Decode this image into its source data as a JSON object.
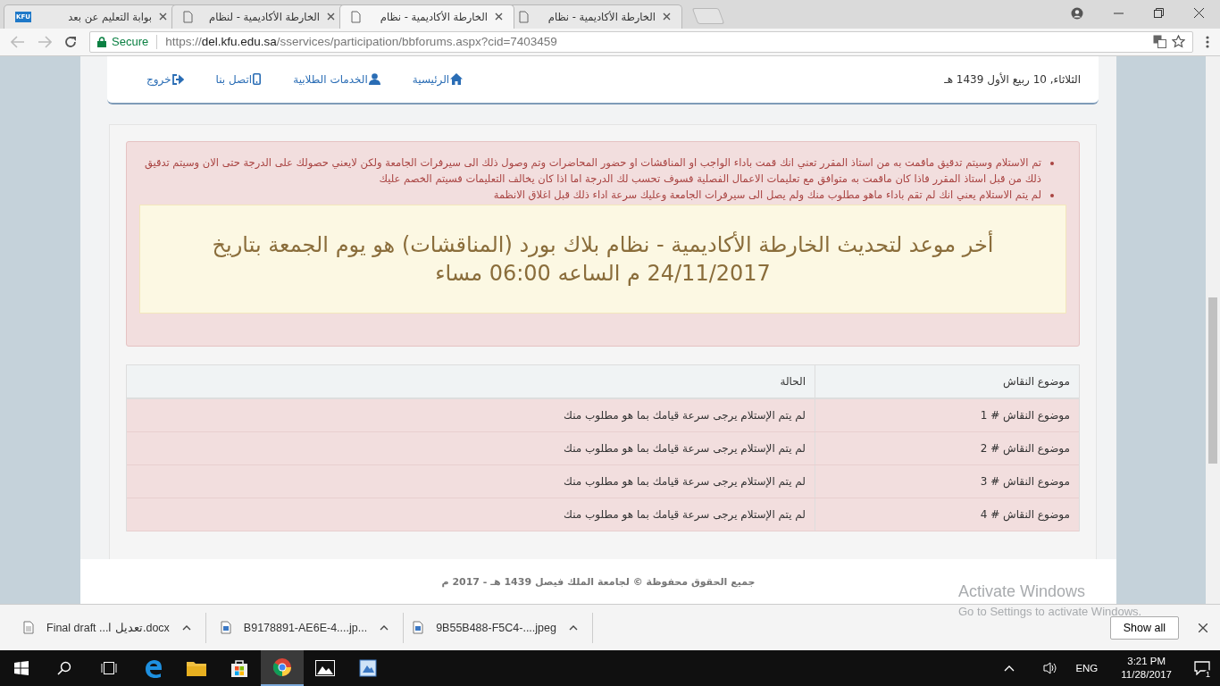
{
  "tabs": [
    {
      "title": "الخارطة الأكاديمية - نظام",
      "kind": "page",
      "selected": false
    },
    {
      "title": "الخارطة الأكاديمية - نظام",
      "kind": "page",
      "selected": true
    },
    {
      "title": "الخارطة الأكاديمية - لنظام",
      "kind": "page",
      "selected": false
    },
    {
      "title": "بوابة التعليم عن بعد",
      "kind": "logo",
      "logo_text": "KFU",
      "selected": false
    }
  ],
  "address_bar": {
    "secure_label": "Secure",
    "url_scheme": "https://",
    "url_host": "del.kfu.edu.sa",
    "url_path": "/sservices/participation/bbforums.aspx?cid=7403459"
  },
  "header": {
    "date": "الثلاثاء, 10 ربيع الأول 1439 هـ",
    "nav": [
      {
        "label": "الرئيسية",
        "kind": "home"
      },
      {
        "label": "الخدمات الطلابية",
        "kind": "user"
      },
      {
        "label": "اتصل بنا",
        "kind": "phone"
      },
      {
        "label": "خروج",
        "kind": "logout"
      }
    ]
  },
  "alert": {
    "bullets": [
      "تم الاستلام وسيتم تدقيق ماقمت به من استاذ المقرر تعني انك قمت باداء الواجب او المناقشات او حضور المحاضرات وتم وصول ذلك الى سيرفرات الجامعة ولكن لايعني حصولك على الدرجة حتى الان وسيتم تدقيق ذلك من قبل استاذ المقرر فاذا كان ماقمت به متوافق مع تعليمات الاعمال الفصلية فسوف تحسب لك الدرجة اما اذا كان يخالف التعليمات فسيتم الخصم عليك",
      "لم يتم الاستلام يعني انك لم تقم باداء ماهو مطلوب منك ولم يصل الى سيرفرات الجامعة وعليك سرعة اداء ذلك قبل اغلاق الانظمة"
    ],
    "notice": "أخر موعد لتحديث الخارطة الأكاديمية - نظام بلاك بورد (المناقشات) هو يوم الجمعة بتاريخ 24/11/2017 م الساعه 06:00 مساء"
  },
  "table": {
    "columns": [
      "موضوع النقاش",
      "الحالة"
    ],
    "rows": [
      [
        "موضوع النقاش # 1",
        "لم يتم الإستلام يرجى سرعة قيامك بما هو مطلوب منك"
      ],
      [
        "موضوع النقاش # 2",
        "لم يتم الإستلام يرجى سرعة قيامك بما هو مطلوب منك"
      ],
      [
        "موضوع النقاش # 3",
        "لم يتم الإستلام يرجى سرعة قيامك بما هو مطلوب منك"
      ],
      [
        "موضوع النقاش # 4",
        "لم يتم الإستلام يرجى سرعة قيامك بما هو مطلوب منك"
      ]
    ]
  },
  "footer": "جميع الحقوق محفوظة © لجامعة الملك فيصل 1439 هـ - 2017 م",
  "activation": {
    "title": "Activate Windows",
    "subtitle": "Go to Settings to activate Windows."
  },
  "downloads": [
    {
      "name": "9B55B488-F5C4-....jpeg",
      "kind": "image"
    },
    {
      "name": "B9178891-AE6E-4....jp...",
      "kind": "image"
    },
    {
      "name": "Final draft ...تعديل ا.docx",
      "kind": "doc"
    }
  ],
  "show_all": "Show all",
  "taskbar": {
    "apps": [
      {
        "kind": "edge",
        "selected": false
      },
      {
        "kind": "folder",
        "selected": false
      },
      {
        "kind": "store",
        "selected": false
      },
      {
        "kind": "chrome",
        "selected": true
      },
      {
        "kind": "photos",
        "selected": false
      },
      {
        "kind": "paint",
        "selected": false
      }
    ],
    "language": "ENG",
    "time": "3:21 PM",
    "date": "11/28/2017",
    "notifications": "1"
  }
}
